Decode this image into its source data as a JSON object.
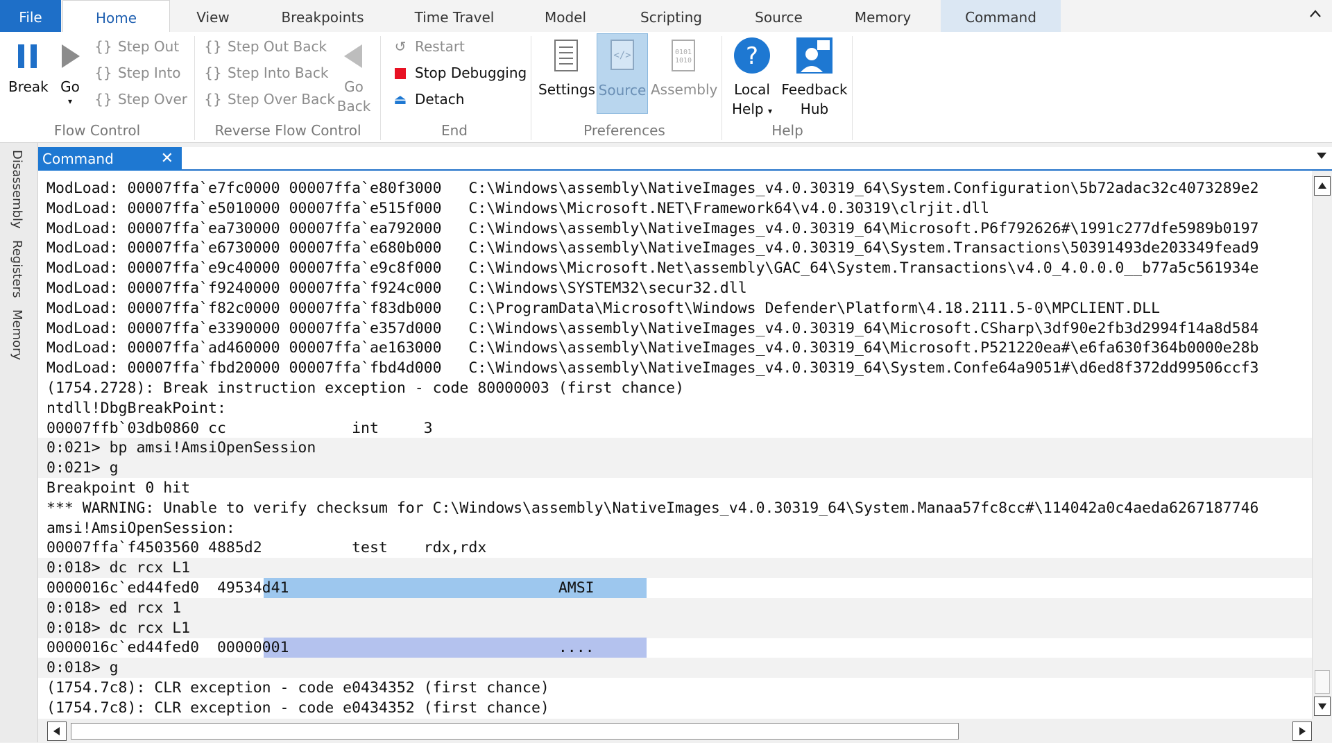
{
  "tabs": [
    "File",
    "Home",
    "View",
    "Breakpoints",
    "Time Travel",
    "Model",
    "Scripting",
    "Source",
    "Memory",
    "Command"
  ],
  "ribbon": {
    "flow_control": {
      "break": "Break",
      "go": "Go",
      "step_out": "Step Out",
      "step_into": "Step Into",
      "step_over": "Step Over",
      "group": "Flow Control"
    },
    "reverse_flow": {
      "step_out_back": "Step Out Back",
      "step_into_back": "Step Into Back",
      "step_over_back": "Step Over Back",
      "go_back_1": "Go",
      "go_back_2": "Back",
      "group": "Reverse Flow Control"
    },
    "end": {
      "restart": "Restart",
      "stop": "Stop Debugging",
      "detach": "Detach",
      "group": "End"
    },
    "preferences": {
      "settings": "Settings",
      "source": "Source",
      "assembly": "Assembly",
      "group": "Preferences"
    },
    "help": {
      "local_help_1": "Local",
      "local_help_2": "Help",
      "feedback_1": "Feedback",
      "feedback_2": "Hub",
      "group": "Help"
    }
  },
  "side_tabs": [
    "Disassembly",
    "Registers",
    "Memory"
  ],
  "command_window": {
    "title": "Command",
    "lines": [
      {
        "text": "ModLoad: 00007ffa`e7fc0000 00007ffa`e80f3000   C:\\Windows\\assembly\\NativeImages_v4.0.30319_64\\System.Configuration\\5b72adac32c4073289e2",
        "kind": "output"
      },
      {
        "text": "ModLoad: 00007ffa`e5010000 00007ffa`e515f000   C:\\Windows\\Microsoft.NET\\Framework64\\v4.0.30319\\clrjit.dll",
        "kind": "output"
      },
      {
        "text": "ModLoad: 00007ffa`ea730000 00007ffa`ea792000   C:\\Windows\\assembly\\NativeImages_v4.0.30319_64\\Microsoft.P6f792626#\\1991c277dfe5989b0197",
        "kind": "output"
      },
      {
        "text": "ModLoad: 00007ffa`e6730000 00007ffa`e680b000   C:\\Windows\\assembly\\NativeImages_v4.0.30319_64\\System.Transactions\\50391493de203349fead9",
        "kind": "output"
      },
      {
        "text": "ModLoad: 00007ffa`e9c40000 00007ffa`e9c8f000   C:\\Windows\\Microsoft.Net\\assembly\\GAC_64\\System.Transactions\\v4.0_4.0.0.0__b77a5c561934e",
        "kind": "output"
      },
      {
        "text": "ModLoad: 00007ffa`f9240000 00007ffa`f924c000   C:\\Windows\\SYSTEM32\\secur32.dll",
        "kind": "output"
      },
      {
        "text": "ModLoad: 00007ffa`f82c0000 00007ffa`f83db000   C:\\ProgramData\\Microsoft\\Windows Defender\\Platform\\4.18.2111.5-0\\MPCLIENT.DLL",
        "kind": "output"
      },
      {
        "text": "ModLoad: 00007ffa`e3390000 00007ffa`e357d000   C:\\Windows\\assembly\\NativeImages_v4.0.30319_64\\Microsoft.CSharp\\3df90e2fb3d2994f14a8d584",
        "kind": "output"
      },
      {
        "text": "ModLoad: 00007ffa`ad460000 00007ffa`ae163000   C:\\Windows\\assembly\\NativeImages_v4.0.30319_64\\Microsoft.P521220ea#\\e6fa630f364b0000e28b",
        "kind": "output"
      },
      {
        "text": "ModLoad: 00007ffa`fbd20000 00007ffa`fbd4d000   C:\\Windows\\assembly\\NativeImages_v4.0.30319_64\\System.Confe64a9051#\\d6ed8f372dd99506ccf3",
        "kind": "output"
      },
      {
        "text": "(1754.2728): Break instruction exception - code 80000003 (first chance)",
        "kind": "output"
      },
      {
        "text": "ntdll!DbgBreakPoint:",
        "kind": "output"
      },
      {
        "text": "00007ffb`03db0860 cc              int     3",
        "kind": "output"
      },
      {
        "text": "0:021> bp amsi!AmsiOpenSession",
        "kind": "prompt"
      },
      {
        "text": "0:021> g",
        "kind": "prompt"
      },
      {
        "text": "Breakpoint 0 hit",
        "kind": "output"
      },
      {
        "text": "*** WARNING: Unable to verify checksum for C:\\Windows\\assembly\\NativeImages_v4.0.30319_64\\System.Manaa57fc8cc#\\114042a0c4aeda6267187746",
        "kind": "output"
      },
      {
        "text": "amsi!AmsiOpenSession:",
        "kind": "output"
      },
      {
        "text": "00007ffa`f4503560 4885d2          test    rdx,rdx",
        "kind": "output"
      },
      {
        "text": "0:018> dc rcx L1",
        "kind": "prompt"
      },
      {
        "text": "0000016c`ed44fed0  49534d41                              AMSI",
        "kind": "hl1"
      },
      {
        "text": "0:018> ed rcx 1",
        "kind": "prompt"
      },
      {
        "text": "0:018> dc rcx L1",
        "kind": "prompt"
      },
      {
        "text": "0000016c`ed44fed0  00000001                              ....",
        "kind": "hl2"
      },
      {
        "text": "0:018> g",
        "kind": "prompt"
      },
      {
        "text": "(1754.7c8): CLR exception - code e0434352 (first chance)",
        "kind": "output"
      },
      {
        "text": "(1754.7c8): CLR exception - code e0434352 (first chance)",
        "kind": "output"
      }
    ]
  },
  "colors": {
    "accent": "#1e6fc8",
    "highlight1": "#9dc7ee",
    "highlight2": "#b4c2ee"
  }
}
